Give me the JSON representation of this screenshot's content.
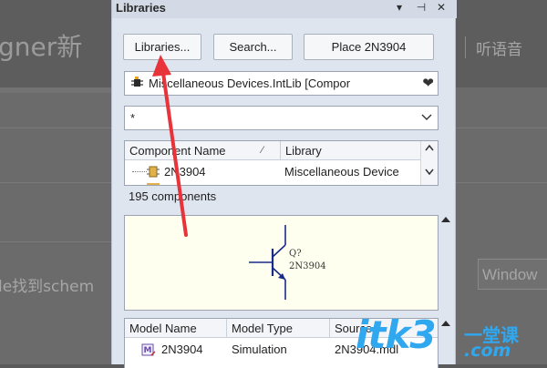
{
  "background": {
    "left_title": "gner新",
    "left_text": "le找到schem",
    "right_title": "听语音",
    "right_button": "Window"
  },
  "panel": {
    "title": "Libraries",
    "header_icons": [
      "▾",
      "⊣",
      "✕"
    ],
    "buttons": {
      "libraries": "Libraries...",
      "search": "Search...",
      "place": "Place 2N3904"
    },
    "library_combo": {
      "value": "Miscellaneous Devices.IntLib [Compor"
    },
    "filter_combo": {
      "value": "*"
    },
    "components": {
      "columns": [
        "Component Name",
        "Library"
      ],
      "rows": [
        {
          "name": "2N3904",
          "library": "Miscellaneous Device"
        }
      ],
      "count_text": "195 components"
    },
    "preview": {
      "designator": "Q?",
      "part": "2N3904"
    },
    "models": {
      "columns": [
        "Model Name",
        "Model Type",
        "Source"
      ],
      "rows": [
        {
          "name": "2N3904",
          "type": "Simulation",
          "source": "2N3904.mdl"
        }
      ]
    }
  },
  "watermark": {
    "brand": "itk3",
    "tagline": "一堂课",
    "domain": ".com"
  },
  "colors": {
    "panel_bg": "#dfe5ee",
    "preview_bg": "#fffff0",
    "arrow": "#e8333a",
    "watermark": "#2fa8f0"
  }
}
